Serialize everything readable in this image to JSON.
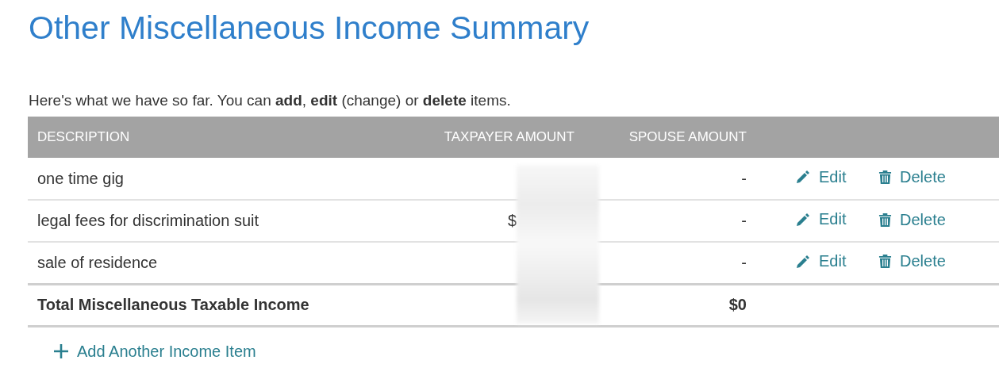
{
  "title": "Other Miscellaneous Income Summary",
  "intro": "Here's what we have so far. You can **add**, **edit** (change) or **delete** items.",
  "table": {
    "columns": [
      "DESCRIPTION",
      "TAXPAYER AMOUNT",
      "SPOUSE AMOUNT"
    ],
    "rows": [
      {
        "description": "one time gig",
        "spouse_amount": "-",
        "edit": "Edit",
        "delete": "Delete"
      },
      {
        "description": "legal fees for discrimination suit",
        "taxpayer_amount": "$",
        "spouse_amount": "-",
        "edit": "Edit",
        "delete": "Delete"
      },
      {
        "description": "sale of residence",
        "spouse_amount": "-",
        "edit": "Edit",
        "delete": "Delete"
      }
    ],
    "total": {
      "label": "Total Miscellaneous Taxable Income",
      "spouse_amount": "$0"
    }
  },
  "add_link": "Add Another Income Item"
}
